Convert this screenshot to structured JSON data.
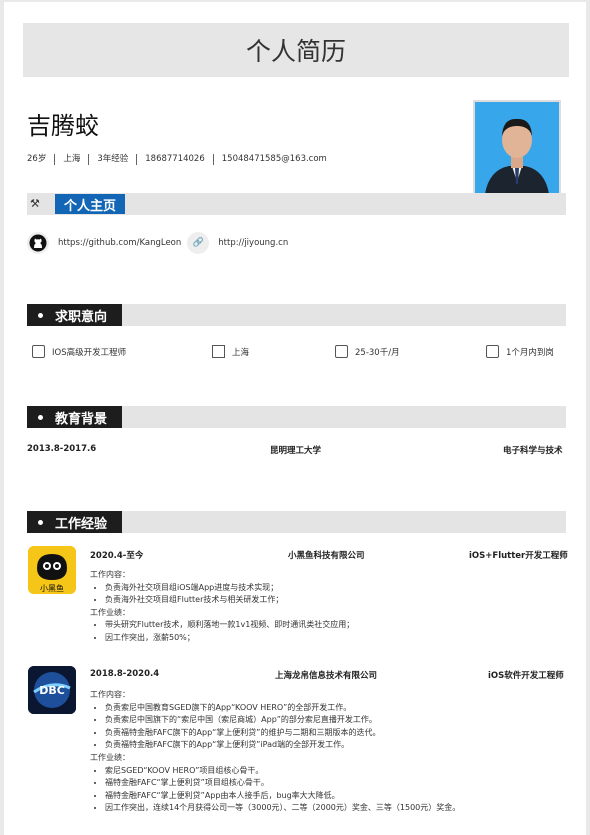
{
  "banner_title": "个人简历",
  "name": "吉腾蛟",
  "info": [
    "26岁",
    "上海",
    "3年经验",
    "18687714026",
    "15048471585@163.com"
  ],
  "sections": {
    "homepage": "个人主页",
    "intent": "求职意向",
    "education": "教育背景",
    "work": "工作经验"
  },
  "homepage_links": [
    "https://github.com/KangLeon",
    "http://jiyoung.cn"
  ],
  "intent": {
    "position": "IOS高级开发工程师",
    "city": "上海",
    "salary": "25-30千/月",
    "availability": "1个月内到岗"
  },
  "education": {
    "period": "2013.8-2017.6",
    "school": "昆明理工大学",
    "major": "电子科学与技术"
  },
  "jobs": [
    {
      "period": "2020.4-至今",
      "company": "小黑鱼科技有限公司",
      "title": "iOS+Flutter开发工程师",
      "logo_text": "小黑鱼",
      "content_label": "工作内容：",
      "content": [
        "负责海外社交项目组iOS端App进度与技术实现；",
        "负责海外社交项目组Flutter技术与相关研发工作；"
      ],
      "result_label": "工作业绩：",
      "results": [
        "带头研究Flutter技术，顺利落地一款1v1视频、即时通讯类社交应用；",
        "因工作突出，涨薪50%；"
      ]
    },
    {
      "period": "2018.8-2020.4",
      "company": "上海龙帛信息技术有限公司",
      "title": "iOS软件开发工程师",
      "logo_text": "DBC",
      "content_label": "工作内容：",
      "content": [
        "负责索尼中国教育SGED旗下的App“KOOV HERO”的全部开发工作。",
        "负责索尼中国旗下的“索尼中国（索尼商城）App”的部分索尼直播开发工作。",
        "负责福特金融FAFC旗下的App“掌上便利贷”的维护与二期和三期版本的迭代。",
        "负责福特金融FAFC旗下的App“掌上便利贷”iPad端的全部开发工作。"
      ],
      "result_label": "工作业绩：",
      "results": [
        "索尼SGED“KOOV HERO”项目组核心骨干。",
        "福特金融FAFC“掌上便利贷”项目组核心骨干。",
        "福特金融FAFC“掌上便利贷”App由本人接手后，bug率大大降低。",
        "因工作突出，连续14个月获得公司一等（3000元）、二等（2000元）奖金、三等（1500元）奖金。"
      ]
    }
  ]
}
